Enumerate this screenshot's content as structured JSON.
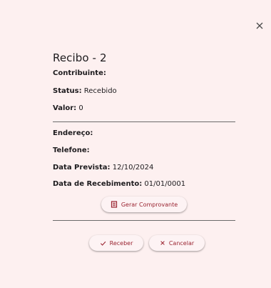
{
  "dialog": {
    "title": "Recibo - 2",
    "fields": {
      "contribuinte": {
        "label": "Contribuinte:",
        "value": ""
      },
      "status": {
        "label": "Status:",
        "value": " Recebido"
      },
      "valor": {
        "label": "Valor:",
        "value": " 0"
      },
      "endereco": {
        "label": "Endereço:",
        "value": ""
      },
      "telefone": {
        "label": "Telefone:",
        "value": ""
      },
      "data_prevista": {
        "label": "Data Prevista:",
        "value": " 12/10/2024"
      },
      "data_recebimento": {
        "label": "Data de Recebimento:",
        "value": " 01/01/0001"
      }
    },
    "buttons": {
      "gerar_comprovante": {
        "label": "Gerar Comprovante",
        "icon": "receipt-icon"
      },
      "receber": {
        "label": "Receber",
        "icon": "check-icon"
      },
      "cancelar": {
        "label": "Cancelar",
        "icon": "close-icon"
      }
    },
    "close_icon": "close-icon"
  },
  "colors": {
    "background": "#fdf0f0",
    "accent": "#9a2330",
    "text": "#1d1b1e"
  }
}
